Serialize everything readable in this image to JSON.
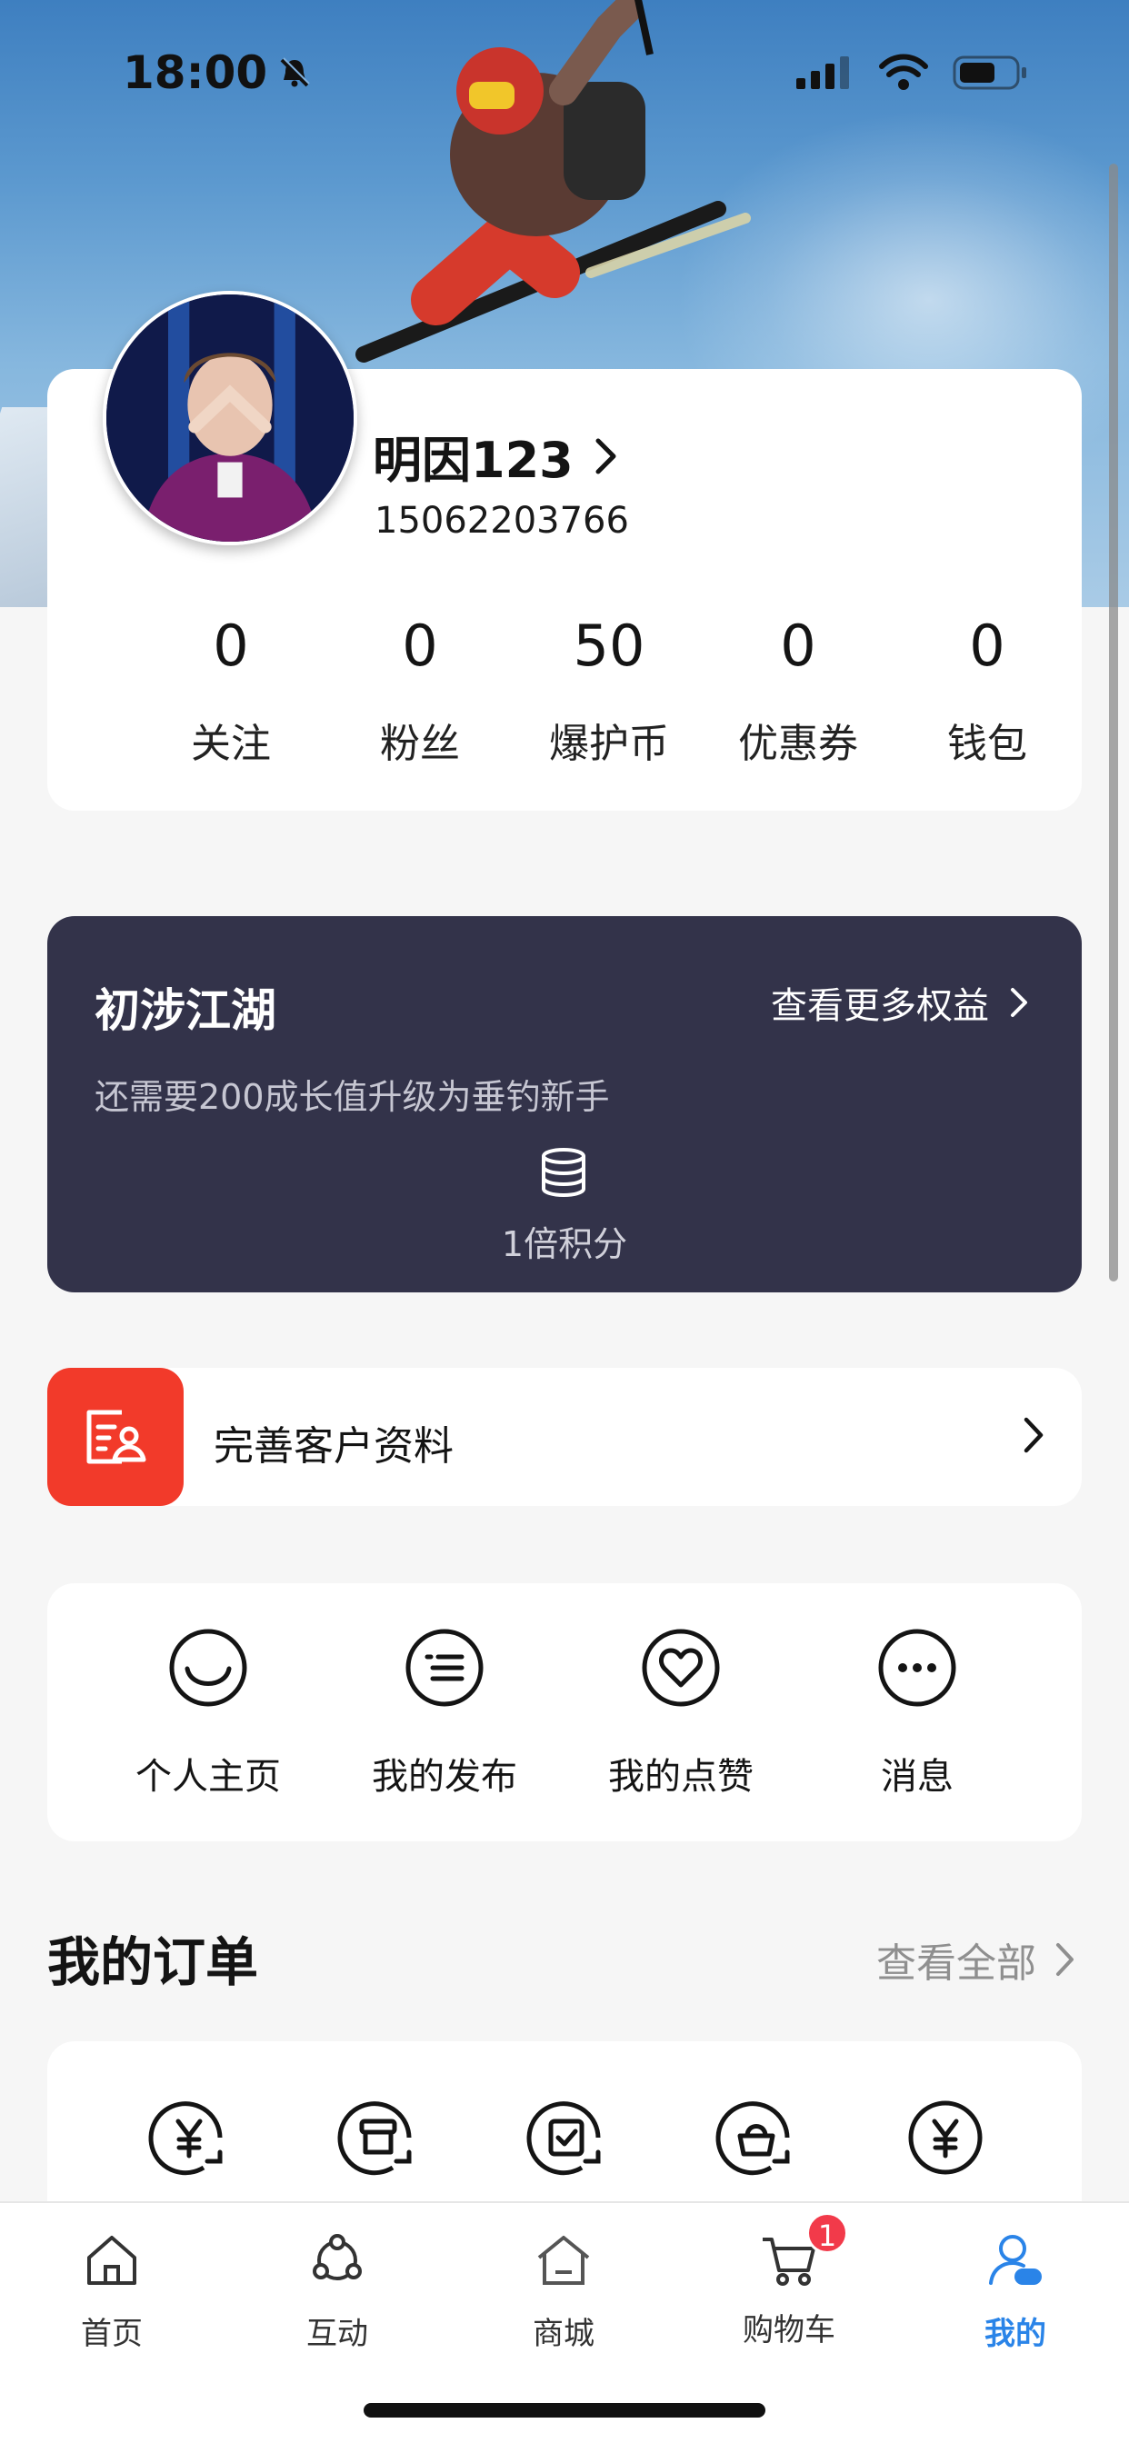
{
  "status_bar": {
    "time": "18:00"
  },
  "profile": {
    "username": "明因123",
    "phone": "15062203766",
    "stats": [
      {
        "value": "0",
        "label": "关注"
      },
      {
        "value": "0",
        "label": "粉丝"
      },
      {
        "value": "50",
        "label": "爆护币"
      },
      {
        "value": "0",
        "label": "优惠券"
      },
      {
        "value": "0",
        "label": "钱包"
      }
    ]
  },
  "level": {
    "title": "初涉江湖",
    "more_label": "查看更多权益",
    "description": "还需要200成长值升级为垂钓新手",
    "multiplier": "1倍积分"
  },
  "complete_profile": {
    "label": "完善客户资料"
  },
  "actions": [
    {
      "label": "个人主页",
      "icon": "smile-icon"
    },
    {
      "label": "我的发布",
      "icon": "list-icon"
    },
    {
      "label": "我的点赞",
      "icon": "heart-icon"
    },
    {
      "label": "消息",
      "icon": "more-dots-icon"
    }
  ],
  "orders": {
    "title": "我的订单",
    "view_all": "查看全部",
    "icons": [
      "payment-icon",
      "box-icon",
      "check-icon",
      "bag-icon",
      "yen-icon"
    ]
  },
  "tabbar": {
    "items": [
      {
        "label": "首页",
        "icon": "home-icon"
      },
      {
        "label": "互动",
        "icon": "interact-icon"
      },
      {
        "label": "商城",
        "icon": "mall-icon"
      },
      {
        "label": "购物车",
        "icon": "cart-icon",
        "badge": "1"
      },
      {
        "label": "我的",
        "icon": "profile-icon",
        "active": true
      }
    ]
  },
  "colors": {
    "accent_blue": "#2a84e8",
    "level_card_bg": "#33334a",
    "red": "#f23a2a"
  }
}
